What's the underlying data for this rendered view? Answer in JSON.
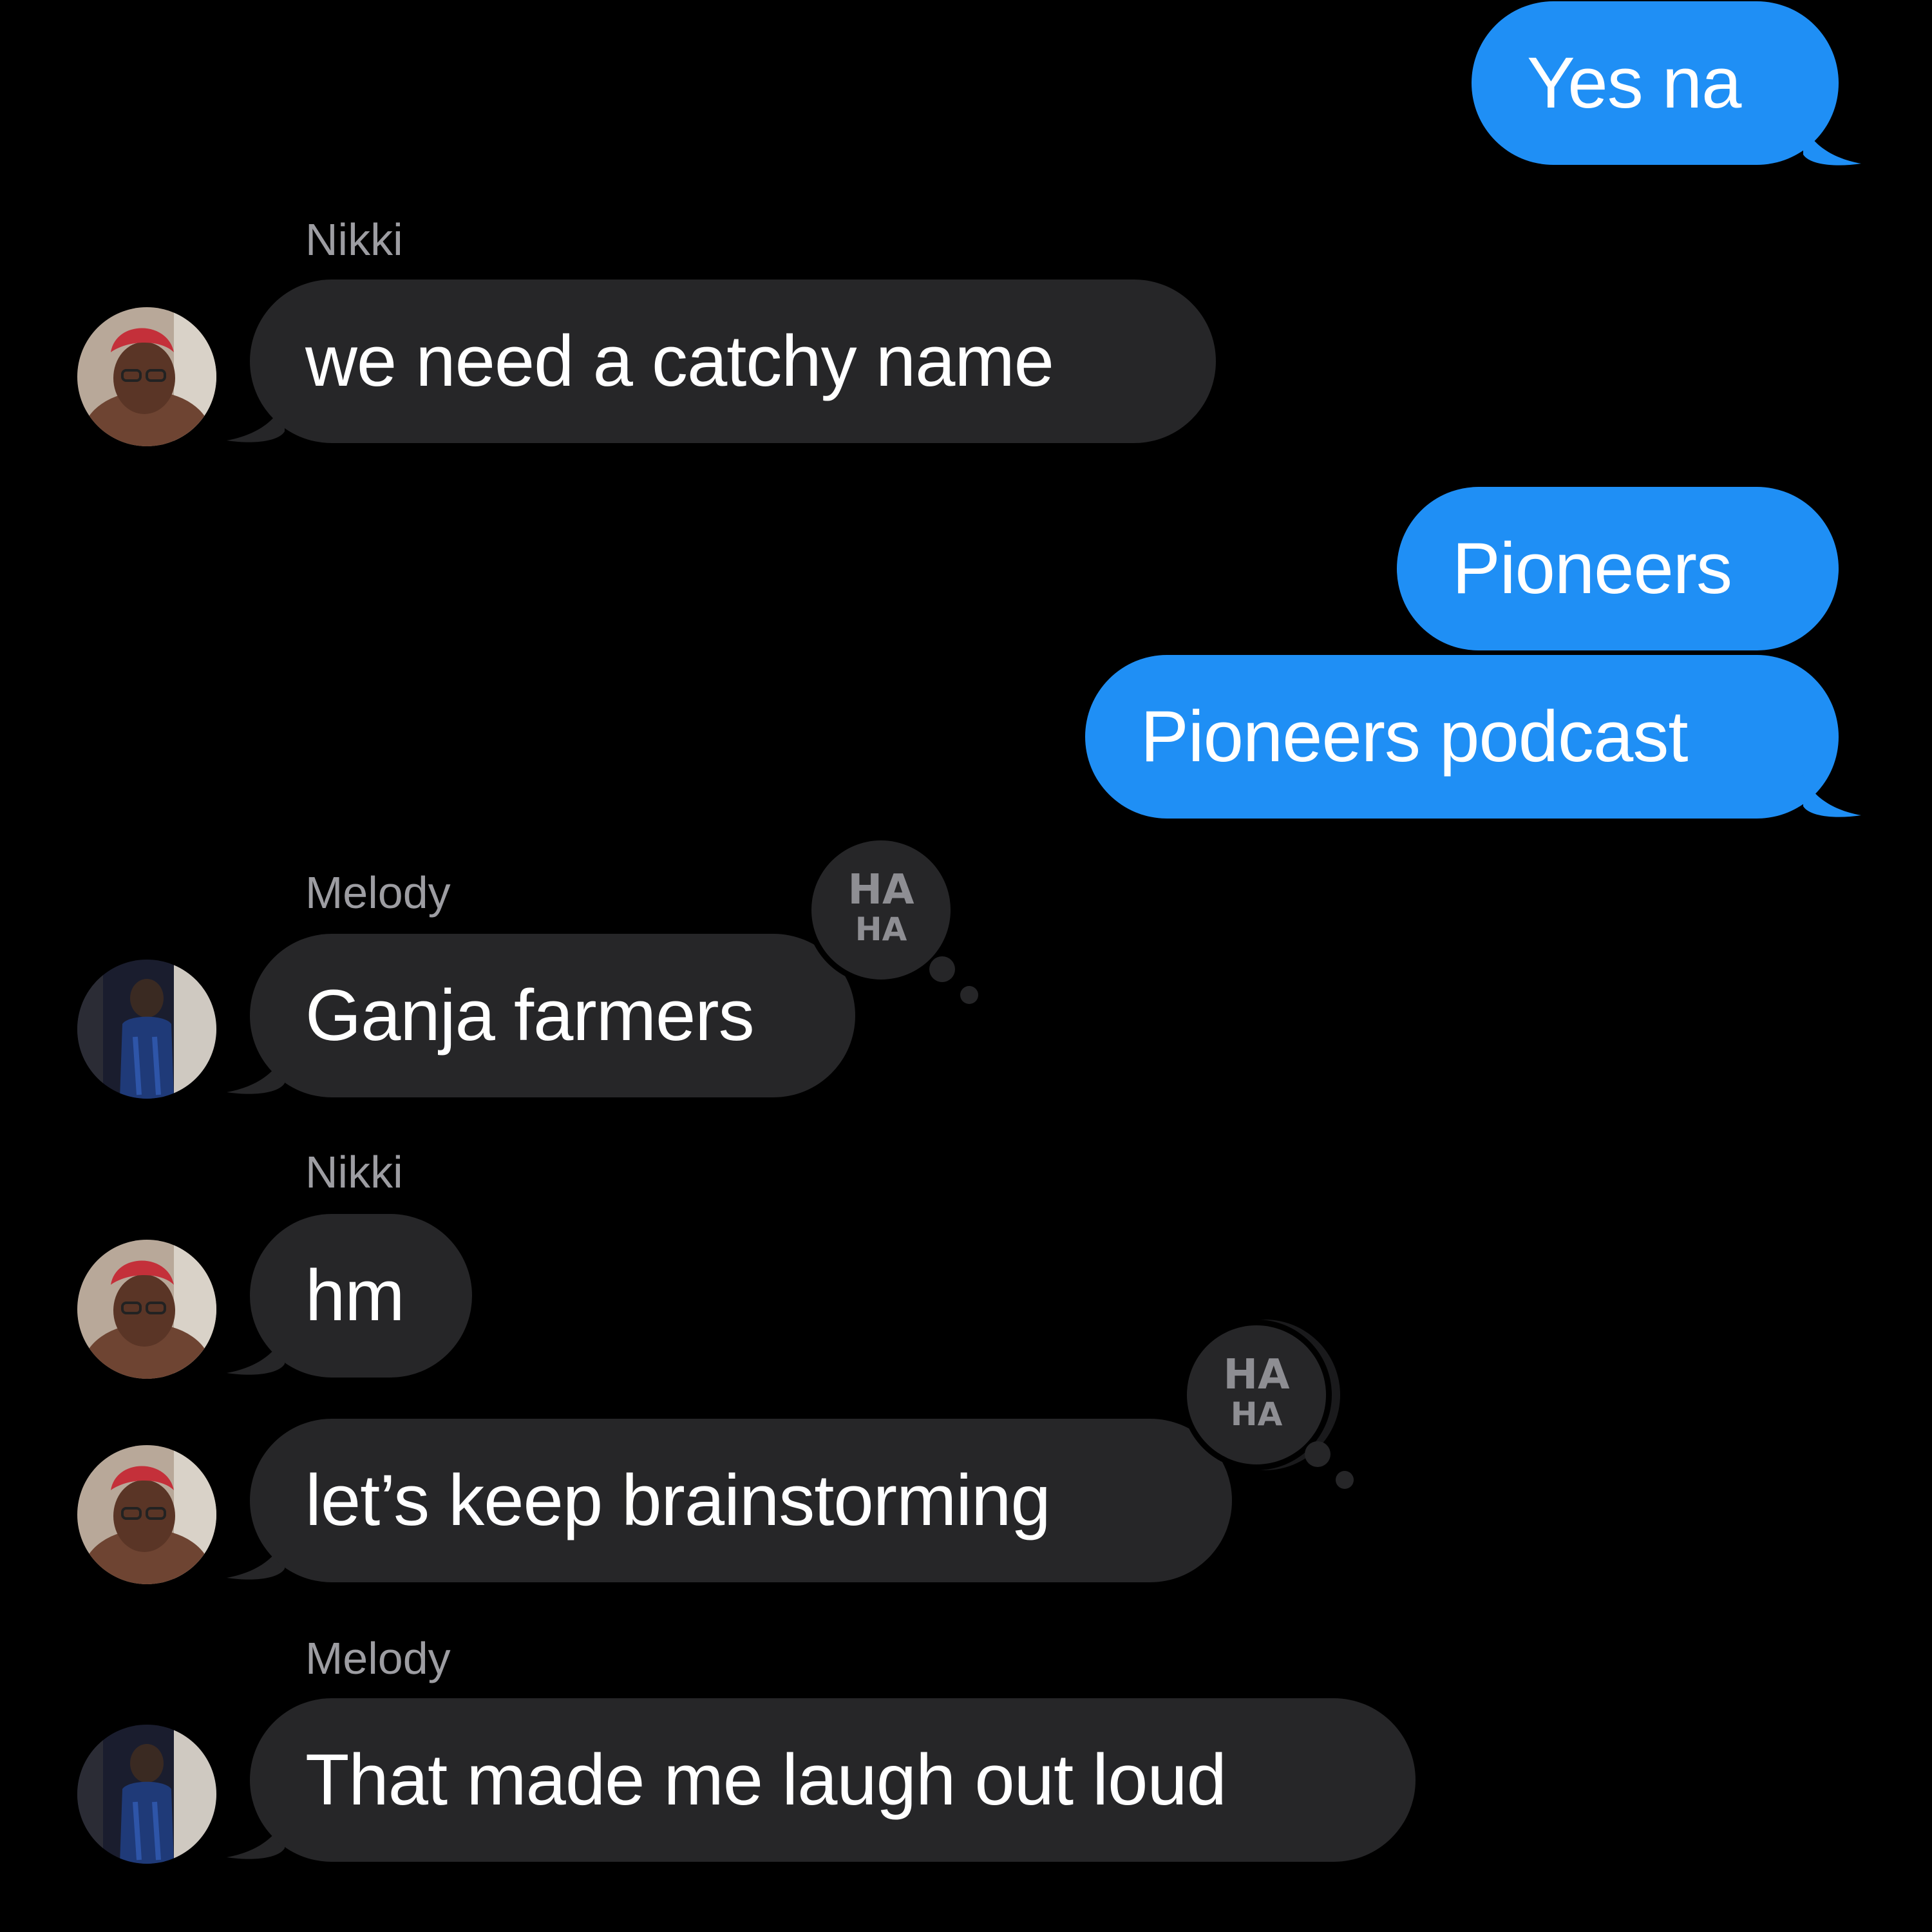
{
  "theme": {
    "background": "#000000",
    "sent_bubble_color": "#1f8ff5",
    "received_bubble_color": "#262628",
    "sender_name_color": "#9d9da2"
  },
  "messages": [
    {
      "direction": "sent",
      "text": "Yes na"
    },
    {
      "direction": "received",
      "sender": "Nikki",
      "text": "we need a catchy name",
      "avatar": "nikki-avatar"
    },
    {
      "direction": "sent",
      "text": "Pioneers"
    },
    {
      "direction": "sent",
      "text": "Pioneers podcast"
    },
    {
      "direction": "received",
      "sender": "Melody",
      "text": "Ganja farmers",
      "avatar": "melody-avatar",
      "reaction": "haha-reaction"
    },
    {
      "direction": "received",
      "sender": "Nikki",
      "text": "hm",
      "avatar": "nikki-avatar"
    },
    {
      "direction": "received",
      "text": "let’s keep brainstorming",
      "avatar": "nikki-avatar",
      "reaction": "haha-reaction"
    },
    {
      "direction": "received",
      "sender": "Melody",
      "text": "That made me laugh out loud",
      "avatar": "melody-avatar"
    }
  ],
  "reaction_label": {
    "top": "HA",
    "bottom": "HA"
  }
}
